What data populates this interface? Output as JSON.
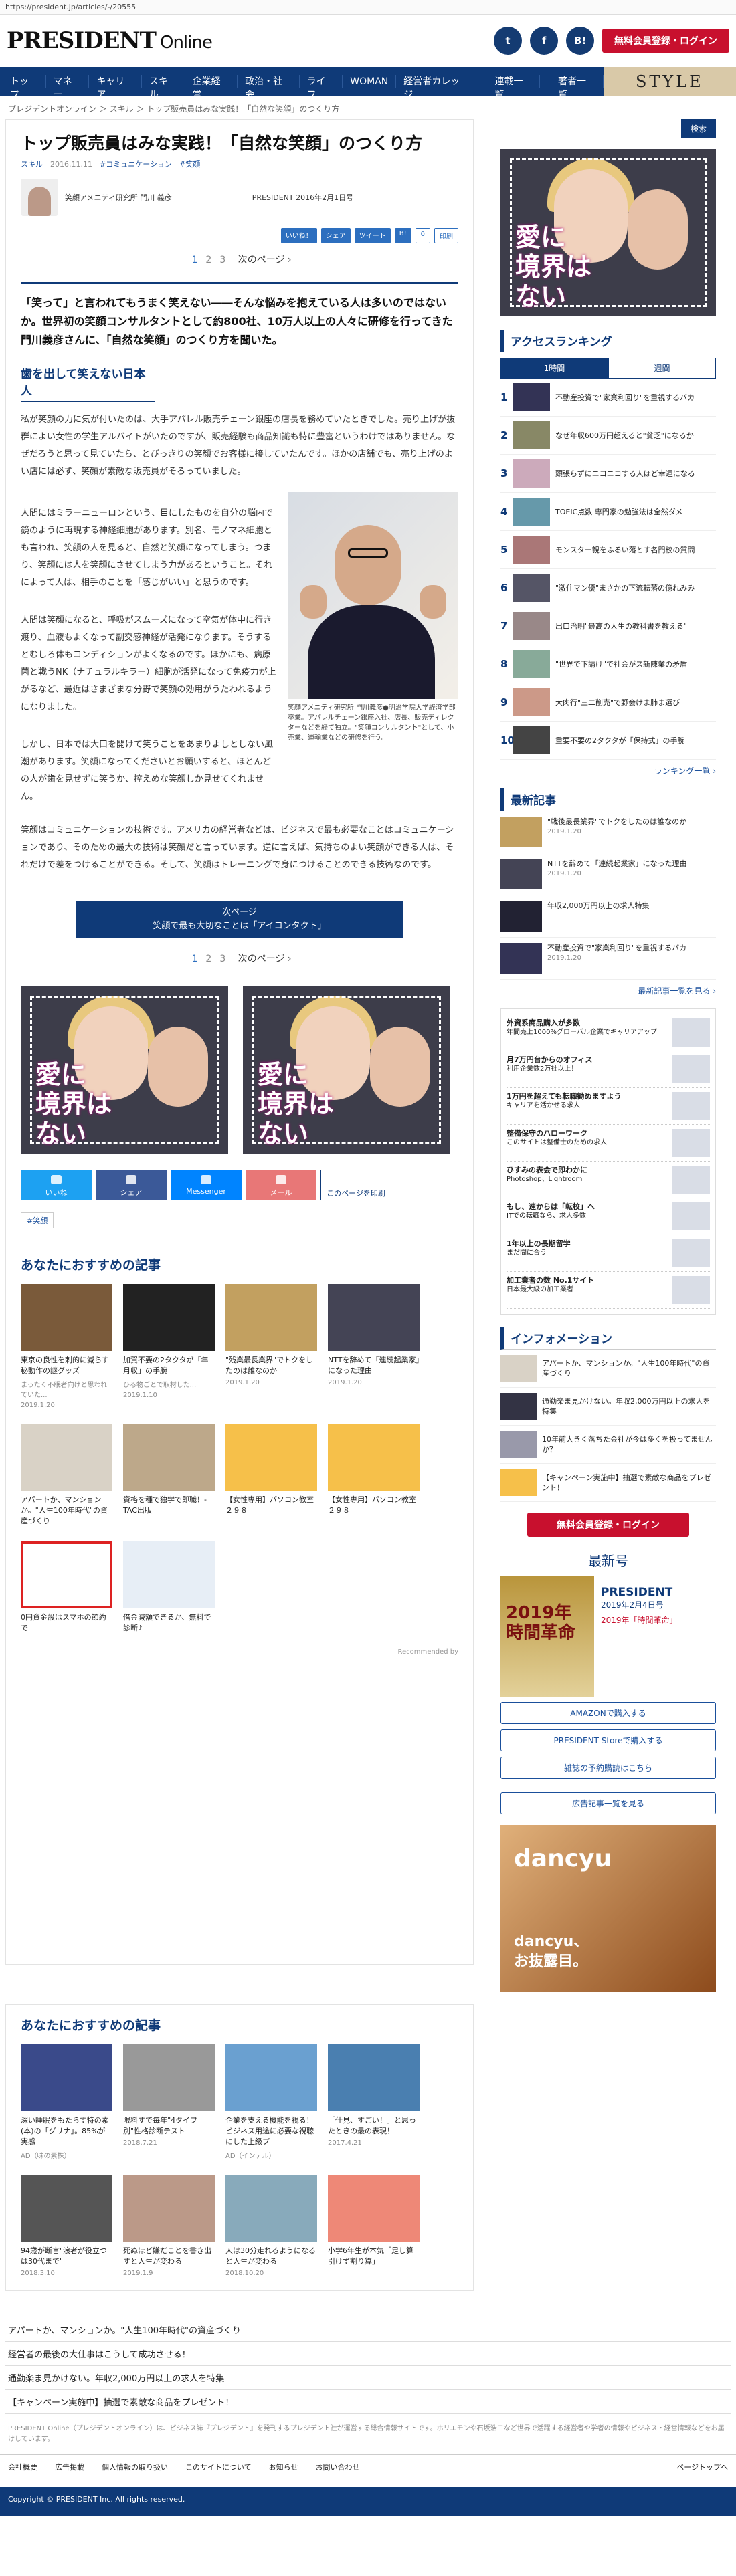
{
  "url": "https://president.jp/articles/-/20555",
  "logo": {
    "main": "PRESIDENT",
    "sub": "Online"
  },
  "header": {
    "social": [
      "t",
      "f",
      "B!"
    ],
    "register": "無料会員登録・ログイン"
  },
  "nav": {
    "items": [
      "トップ",
      "マネー",
      "キャリア",
      "スキル",
      "企業経営",
      "政治・社会",
      "ライフ",
      "WOMAN",
      "経営者カレッジ",
      "連載一覧",
      "著者一覧"
    ],
    "style": "STYLE"
  },
  "breadcrumb": "プレジデントオンライン ＞ スキル ＞ トップ販売員はみな実践！「自然な笑顔」のつくり方",
  "article": {
    "title": "トップ販売員はみな実践！「自然な笑顔」のつくり方",
    "meta": {
      "cat": "スキル",
      "date": "2016.11.11",
      "tags": "#コミュニケーション　#笑顔"
    },
    "author": "笑顔アメニティ研究所 門川 義彦",
    "publication": "PRESIDENT 2016年2月1日号",
    "share": [
      "いいね！",
      "シェア",
      "ツイート",
      "B!",
      "0",
      "印刷"
    ],
    "pager": {
      "p1": "1",
      "p2": "2",
      "p3": "3",
      "next": "次のページ ›"
    },
    "lead": "「笑って」と言われてもうまく笑えない――そんな悩みを抱えている人は多いのではないか。世界初の笑顔コンサルタントとして約800社、10万人以上の人々に研修を行ってきた門川義彦さんに、「自然な笑顔」のつくり方を聞いた。",
    "h2": "歯を出して笑えない日本人",
    "p1": "私が笑顔の力に気が付いたのは、大手アパレル販売チェーン銀座の店長を務めていたときでした。売り上げが抜群によい女性の学生アルバイトがいたのですが、販売経験も商品知識も特に豊富というわけではありません。なぜだろうと思って見ていたら、とびっきりの笑顔でお客様に接していたんです。ほかの店舗でも、売り上げのよい店には必ず、笑顔が素敵な販売員がそろっていました。",
    "p2": "人間にはミラーニューロンという、目にしたものを自分の脳内で鏡のように再現する神経細胞があります。別名、モノマネ細胞とも言われ、笑顔の人を見ると、自然と笑顔になってしまう。つまり、笑顔には人を笑顔にさせてしまう力があるということ。それによって人は、相手のことを「感じがいい」と思うのです。",
    "p3": "人間は笑顔になると、呼吸がスムーズになって空気が体中に行き渡り、血液もよくなって副交感神経が活発になります。そうするとむしろ体もコンディションがよくなるのです。ほかにも、病原菌と戦うNK（ナチュラルキラー）細胞が活発になって免疫力が上がるなど、最近はさまざまな分野で笑顔の効用がうたわれるようになりました。",
    "p4": "しかし、日本では大口を開けて笑うことをあまりよしとしない風潮があります。笑顔になってくださいとお願いすると、ほとんどの人が歯を見せずに笑うか、控えめな笑顔しか見せてくれません。",
    "p5": "笑顔はコミュニケーションの技術です。アメリカの経営者などは、ビジネスで最も必要なことはコミュニケーションであり、そのための最大の技術は笑顔だと言っています。逆に言えば、気持ちのよい笑顔ができる人は、それだけで差をつけることができる。そして、笑顔はトレーニングで身につけることのできる技術なのです。",
    "caption": "笑顔アメニティ研究所 門川義彦●明治学院大学経済学部卒業。アパレルチェーン銀座入社、店長、販売ディレクターなどを経て独立。\"笑顔コンサルタント\"として、小売業、運輸業などの研修を行う。",
    "next_btn": {
      "line1": "次ページ",
      "line2": "笑顔で最も大切なことは「アイコンタクト」"
    },
    "ad_text": "愛に\n境界は\nない",
    "sharebar": [
      "いいね",
      "シェア",
      "Messenger",
      "メール",
      "このページを印刷"
    ],
    "tag": "#笑顔"
  },
  "rec1": {
    "title": "あなたにおすすめの記事",
    "items": [
      {
        "t": "東京の良性を刺的に減らす秘動作の謎グッズ",
        "s": "まったく不眠者向けと思われていた...",
        "d": "2019.1.20"
      },
      {
        "t": "加賀不要の2タクタが「年月収」の手腕",
        "s": "ひる物ごとで取材した...",
        "d": "2019.1.10"
      },
      {
        "t": "\"残業最長業界\"でトクをしたのは誰なのか",
        "s": "",
        "d": "2019.1.20"
      },
      {
        "t": "NTTを辞めて「連続起業家」になった理由",
        "s": "",
        "d": "2019.1.20"
      },
      {
        "t": "アパートか、マンションか。\"人生100年時代\"の資産づくり",
        "s": "",
        "d": ""
      },
      {
        "t": "資格を種で独学で即職！- TAC出版",
        "s": "",
        "d": ""
      },
      {
        "t": "【女性専用】パソコン教室２９８",
        "s": "",
        "d": ""
      },
      {
        "t": "【女性専用】パソコン教室２９８",
        "s": "",
        "d": ""
      },
      {
        "t": "0円資金設はスマホの節約で",
        "s": "",
        "d": ""
      },
      {
        "t": "借金減額できるか、無料で診断♪",
        "s": "",
        "d": ""
      }
    ],
    "recommended": "Recommended by"
  },
  "rec2": {
    "title": "あなたにおすすめの記事",
    "items": [
      {
        "t": "深い睡眠をもたらす特の素(本)の「グリナ」。85%が実感",
        "d": "AD（味の素株）"
      },
      {
        "t": "限料すで毎年\"4タイプ別\"性格診断テスト",
        "d": "2018.7.21"
      },
      {
        "t": "企業を支える機能を視る！ビジネス用途に必要な視聴にした上級プ",
        "d": "AD（インテル）"
      },
      {
        "t": "「仕見、すごい！」と思ったときの最の表現！",
        "d": "2017.4.21"
      },
      {
        "t": "94歳が断言\"浪者が役立つは30代まで\"",
        "d": "2018.3.10"
      },
      {
        "t": "死ぬほど嫌だことを書き出すと人生が変わる",
        "d": "2019.1.9"
      },
      {
        "t": "人は30分走れるようになると人生が変わる",
        "d": "2018.10.20"
      },
      {
        "t": "小学6年生が本気「足し算引けず割り算」",
        "d": ""
      }
    ]
  },
  "bottom_links": [
    "アパートか、マンションか。\"人生100年時代\"の資産づくり",
    "経営者の最後の大仕事はこうして成功させる！",
    "通勤楽ま見かけない。年収2,000万円以上の求人を特集",
    "【キャンペーン実施中】抽選で素敵な商品をプレゼント！"
  ],
  "disclaimer": "PRESIDENT Online（プレジデントオンライン）は、ビジネス誌『プレジデント』を発刊するプレジデント社が運営する総合情報サイトです。ホリエモンや石坂浩二など世界で活躍する経営者や学者の情報やビジネス・経営情報などをお届けしています。",
  "footer": {
    "links": [
      "会社概要",
      "広告掲載",
      "個人情報の取り扱い",
      "このサイトについて",
      "お知らせ",
      "お問い合わせ"
    ],
    "pagetop": "ページトップへ",
    "copyright": "Copyright © PRESIDENT Inc. All rights reserved."
  },
  "side": {
    "search": "検索",
    "ranking_title": "アクセスランキング",
    "tabs": [
      "1時間",
      "週間"
    ],
    "ranking": [
      "不動産投資で\"家業利回り\"を重視するバカ",
      "なぜ年収600万円超えると\"貧乏\"になるか",
      "頭張らずにニコニコする人ほど幸運になる",
      "TOEIC点数 専門家の勉強法は全然ダメ",
      "モンスター親をふるい落とす名門校の質問",
      "\"激住マン優\"まさかの下流転落の億れみみ",
      "出口治明\"最高の人生の教科書を教える\"",
      "\"世界で下請け\"で社会がス新陳業の矛盾",
      "大肉行\"三二削売\"で野会けま肺ま選び",
      "重要不要の2タクタが「保持式」の手腕"
    ],
    "ranking_more": "ランキング一覧 ›",
    "latest_title": "最新記事",
    "latest": [
      {
        "t": "\"戦後最長業界\"でトクをしたのは誰なのか",
        "d": "2019.1.20"
      },
      {
        "t": "NTTを辞めて「連続起業家」になった理由",
        "d": "2019.1.20"
      },
      {
        "t": "年収2,000万円以上の求人特集",
        "d": ""
      },
      {
        "t": "不動産投資で\"家業利回り\"を重視するバカ",
        "d": "2019.1.20"
      }
    ],
    "latest_more": "最新記事一覧を見る ›",
    "ads": [
      {
        "t": "外資系商品購入が多数",
        "s": "年間売上1000%グローバル企業でキャリアアップ"
      },
      {
        "t": "月7万円台からのオフィス",
        "s": "利用企業数2万社以上！"
      },
      {
        "t": "1万円を超えても転職勧めますよう",
        "s": "キャリアを活かせる求人"
      },
      {
        "t": "整備保守のハローワーク",
        "s": "このサイトは整備士のための求人"
      },
      {
        "t": "ひすみの表会で即わかに",
        "s": "Photoshop、Lightroom"
      },
      {
        "t": "もし、速からは「転校」へ",
        "s": "ITでの転職なら、求人多数"
      },
      {
        "t": "1年以上の長期留学",
        "s": "まだ間に合う"
      },
      {
        "t": "加工業者の数 No.1サイト",
        "s": "日本最大級の加工業者"
      }
    ],
    "info_title": "インフォメーション",
    "info": [
      "アパートか、マンションか。\"人生100年時代\"の資産づくり",
      "通勤楽ま見かけない。年収2,000万円以上の求人を特集",
      "10年前大きく落ちた会社が今は多くを扱ってませんか？",
      "【キャンペーン実施中】抽選で素敵な商品をプレゼント！"
    ],
    "register": "無料会員登録・ログイン",
    "mag_title": "最新号",
    "mag": {
      "cover": "2019年\n時間革命",
      "name": "PRESIDENT",
      "date": "2019年2月4日号",
      "feature": "2019年「時間革命」"
    },
    "buy": [
      "AMAZONで購入する",
      "PRESIDENT Storeで購入する",
      "雑誌の予約購読はこちら"
    ],
    "ad_more": "広告記事一覧を見る",
    "dancyu": {
      "t": "dancyu",
      "s": "dancyu、\nお抜露目。"
    }
  }
}
